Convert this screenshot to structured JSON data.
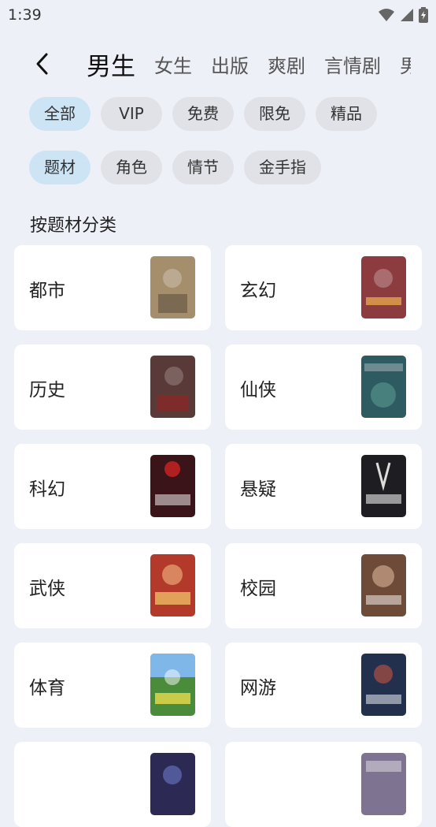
{
  "status": {
    "time": "1:39"
  },
  "nav": {
    "tabs": [
      {
        "label": "男生",
        "active": true
      },
      {
        "label": "女生"
      },
      {
        "label": "出版"
      },
      {
        "label": "爽剧"
      },
      {
        "label": "言情剧"
      },
      {
        "label": "男"
      }
    ]
  },
  "filters": {
    "row1": [
      "全部",
      "VIP",
      "免费",
      "限免",
      "精品"
    ],
    "row2": [
      "题材",
      "角色",
      "情节",
      "金手指"
    ]
  },
  "section": {
    "title": "按题材分类"
  },
  "categories": [
    {
      "label": "都市",
      "cover": "#A58E6C"
    },
    {
      "label": "玄幻",
      "cover": "#8C3B3F"
    },
    {
      "label": "历史",
      "cover": "#5A3A38"
    },
    {
      "label": "仙侠",
      "cover": "#2E5A62"
    },
    {
      "label": "科幻",
      "cover": "#3A1418"
    },
    {
      "label": "悬疑",
      "cover": "#1E1E22"
    },
    {
      "label": "武侠",
      "cover": "#B33A2A"
    },
    {
      "label": "校园",
      "cover": "#6E4A38"
    },
    {
      "label": "体育",
      "cover": "#4B8C3A"
    },
    {
      "label": "网游",
      "cover": "#22304E"
    },
    {
      "label": "",
      "cover": "#2C2A55"
    },
    {
      "label": "",
      "cover": "#7E7390"
    }
  ]
}
